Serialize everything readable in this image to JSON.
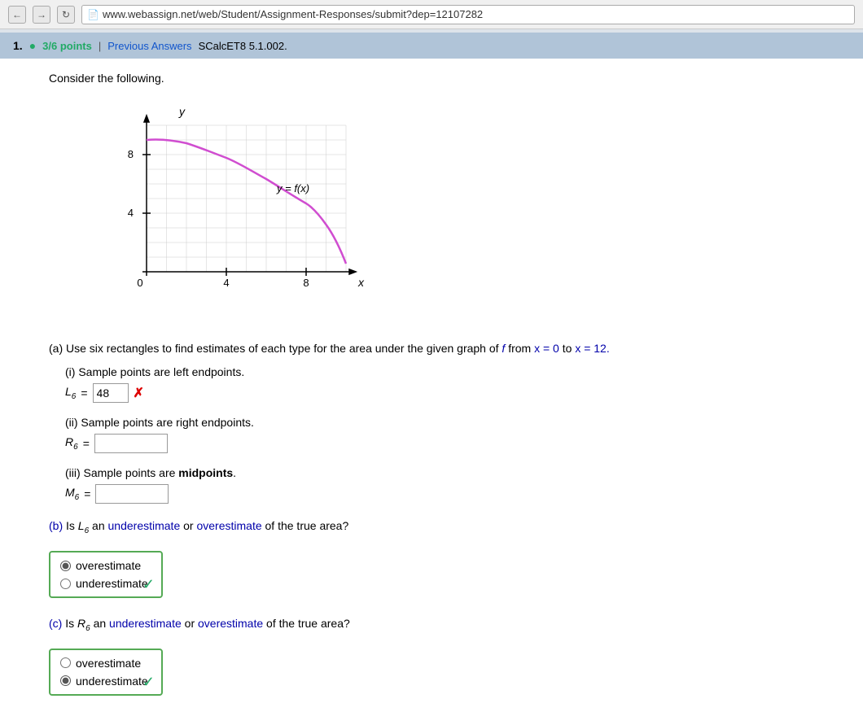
{
  "browser": {
    "url": "www.webassign.net/web/Student/Assignment-Responses/submit?dep=12107282",
    "back_label": "←",
    "forward_label": "→",
    "refresh_label": "C"
  },
  "question": {
    "number": "1.",
    "points_label": "3/6 points",
    "separator": "|",
    "prev_answers_label": "Previous Answers",
    "course_code": "SCalcET8 5.1.002.",
    "consider_text": "Consider the following.",
    "part_a_label": "(a) Use six rectangles to find estimates of each type for the area under the given graph of",
    "part_a_f": "f",
    "part_a_from": "from",
    "part_a_x0": "x = 0",
    "part_a_to": "to",
    "part_a_x12": "x = 12.",
    "subpart_i_label": "(i) Sample points are left endpoints.",
    "subpart_i_eq_left": "L",
    "subpart_i_eq_sub": "6",
    "subpart_i_eq_equals": "=",
    "subpart_i_value": "48",
    "subpart_ii_label": "(ii) Sample points are right endpoints.",
    "subpart_ii_eq_left": "R",
    "subpart_ii_eq_sub": "6",
    "subpart_ii_eq_equals": "=",
    "subpart_iii_label": "(iii) Sample points are midpoints.",
    "subpart_iii_eq_left": "M",
    "subpart_iii_eq_sub": "6",
    "subpart_iii_eq_equals": "=",
    "part_b_label": "(b) Is",
    "part_b_L": "L",
    "part_b_sub": "6",
    "part_b_text": "an underestimate or overestimate of the true area?",
    "radio_b_option1": "overestimate",
    "radio_b_option2": "underestimate",
    "part_c_label": "(c) Is",
    "part_c_R": "R",
    "part_c_sub": "6",
    "part_c_text": "an underestimate or overestimate of the true area?",
    "radio_c_option1": "overestimate",
    "radio_c_option2": "underestimate",
    "graph_y_label": "y",
    "graph_x_label": "x",
    "graph_func_label": "y = f(x)",
    "graph_y4": "4",
    "graph_y8": "8",
    "graph_x4": "4",
    "graph_x8": "8",
    "graph_x0": "0"
  }
}
